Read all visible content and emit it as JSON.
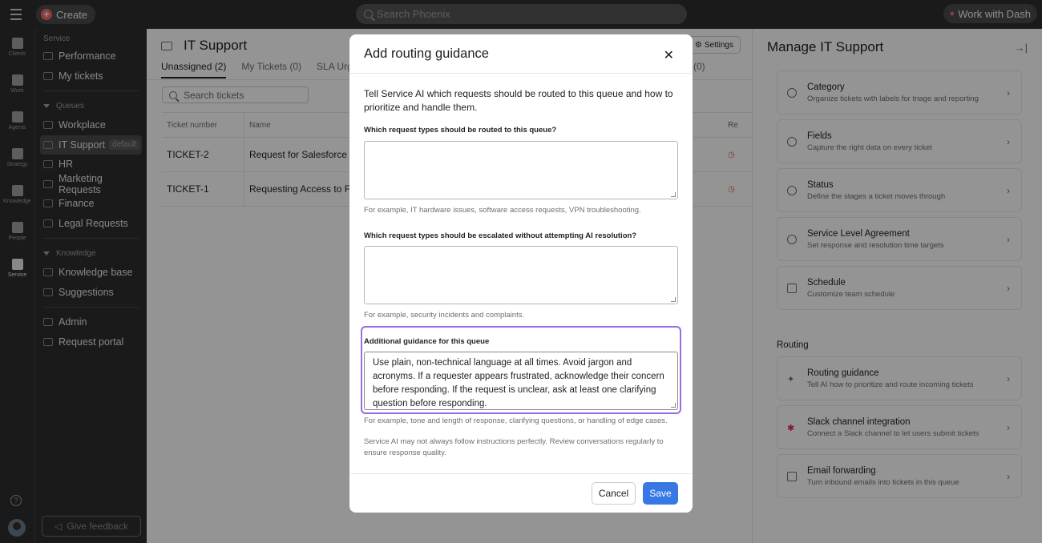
{
  "topbar": {
    "create_label": "Create",
    "search_placeholder": "Search Phoenix",
    "dash_label": "Work with Dash"
  },
  "rail": {
    "items": [
      "Clients",
      "Work",
      "Agents",
      "Strategy",
      "Knowledge",
      "People",
      "Service"
    ]
  },
  "sidebar": {
    "service_section": "Service",
    "performance": "Performance",
    "my_tickets": "My tickets",
    "queues_header": "Queues",
    "queues": [
      "Workplace",
      "IT Support",
      "HR",
      "Marketing Requests",
      "Finance",
      "Legal Requests"
    ],
    "default_tag": "default",
    "knowledge_header": "Knowledge",
    "knowledge_base": "Knowledge base",
    "suggestions": "Suggestions",
    "admin": "Admin",
    "request_portal": "Request portal",
    "feedback": "Give feedback"
  },
  "main": {
    "title": "IT Support",
    "settings": "Settings",
    "tabs": [
      "Unassigned (2)",
      "My Tickets (0)",
      "SLA Urge"
    ],
    "tab_right": "(0)",
    "search_placeholder": "Search tickets",
    "columns": [
      "Ticket number",
      "Name",
      "Re"
    ],
    "rows": [
      {
        "ticket": "TICKET-2",
        "name": "Request for Salesforce Ac"
      },
      {
        "ticket": "TICKET-1",
        "name": "Requesting Access to Fig"
      }
    ]
  },
  "rpanel": {
    "title": "Manage IT Support",
    "cards": [
      {
        "title": "Category",
        "desc": "Organize tickets with labels for triage and reporting"
      },
      {
        "title": "Fields",
        "desc": "Capture the right data on every ticket"
      },
      {
        "title": "Status",
        "desc": "Define the stages a ticket moves through"
      },
      {
        "title": "Service Level Agreement",
        "desc": "Set response and resolution time targets"
      },
      {
        "title": "Schedule",
        "desc": "Customize team schedule"
      }
    ],
    "routing_label": "Routing",
    "routing_cards": [
      {
        "title": "Routing guidance",
        "desc": "Tell AI how to prioritize and route incoming tickets"
      },
      {
        "title": "Slack channel integration",
        "desc": "Connect a Slack channel to let users submit tickets"
      },
      {
        "title": "Email forwarding",
        "desc": "Turn inbound emails into tickets in this queue"
      }
    ]
  },
  "modal": {
    "title": "Add routing guidance",
    "intro": "Tell Service AI which requests should be routed to this queue and how to prioritize and handle them.",
    "q1_label": "Which request types should be routed to this queue?",
    "q1_value": "",
    "q1_hint": "For example, IT hardware issues, software access requests, VPN troubleshooting.",
    "q2_label": "Which request types should be escalated without attempting AI resolution?",
    "q2_value": "",
    "q2_hint": "For example, security incidents and complaints.",
    "q3_label": "Additional guidance for this queue",
    "q3_value": "Use plain, non-technical language at all times. Avoid jargon and acronyms. If a requester appears frustrated, acknowledge their concern before responding. If the request is unclear, ask at least one clarifying question before responding.",
    "q3_hint": "For example, tone and length of response, clarifying questions, or handling of edge cases.",
    "disclaimer": "Service AI may not always follow instructions perfectly. Review conversations regularly to ensure response quality.",
    "cancel": "Cancel",
    "save": "Save"
  }
}
